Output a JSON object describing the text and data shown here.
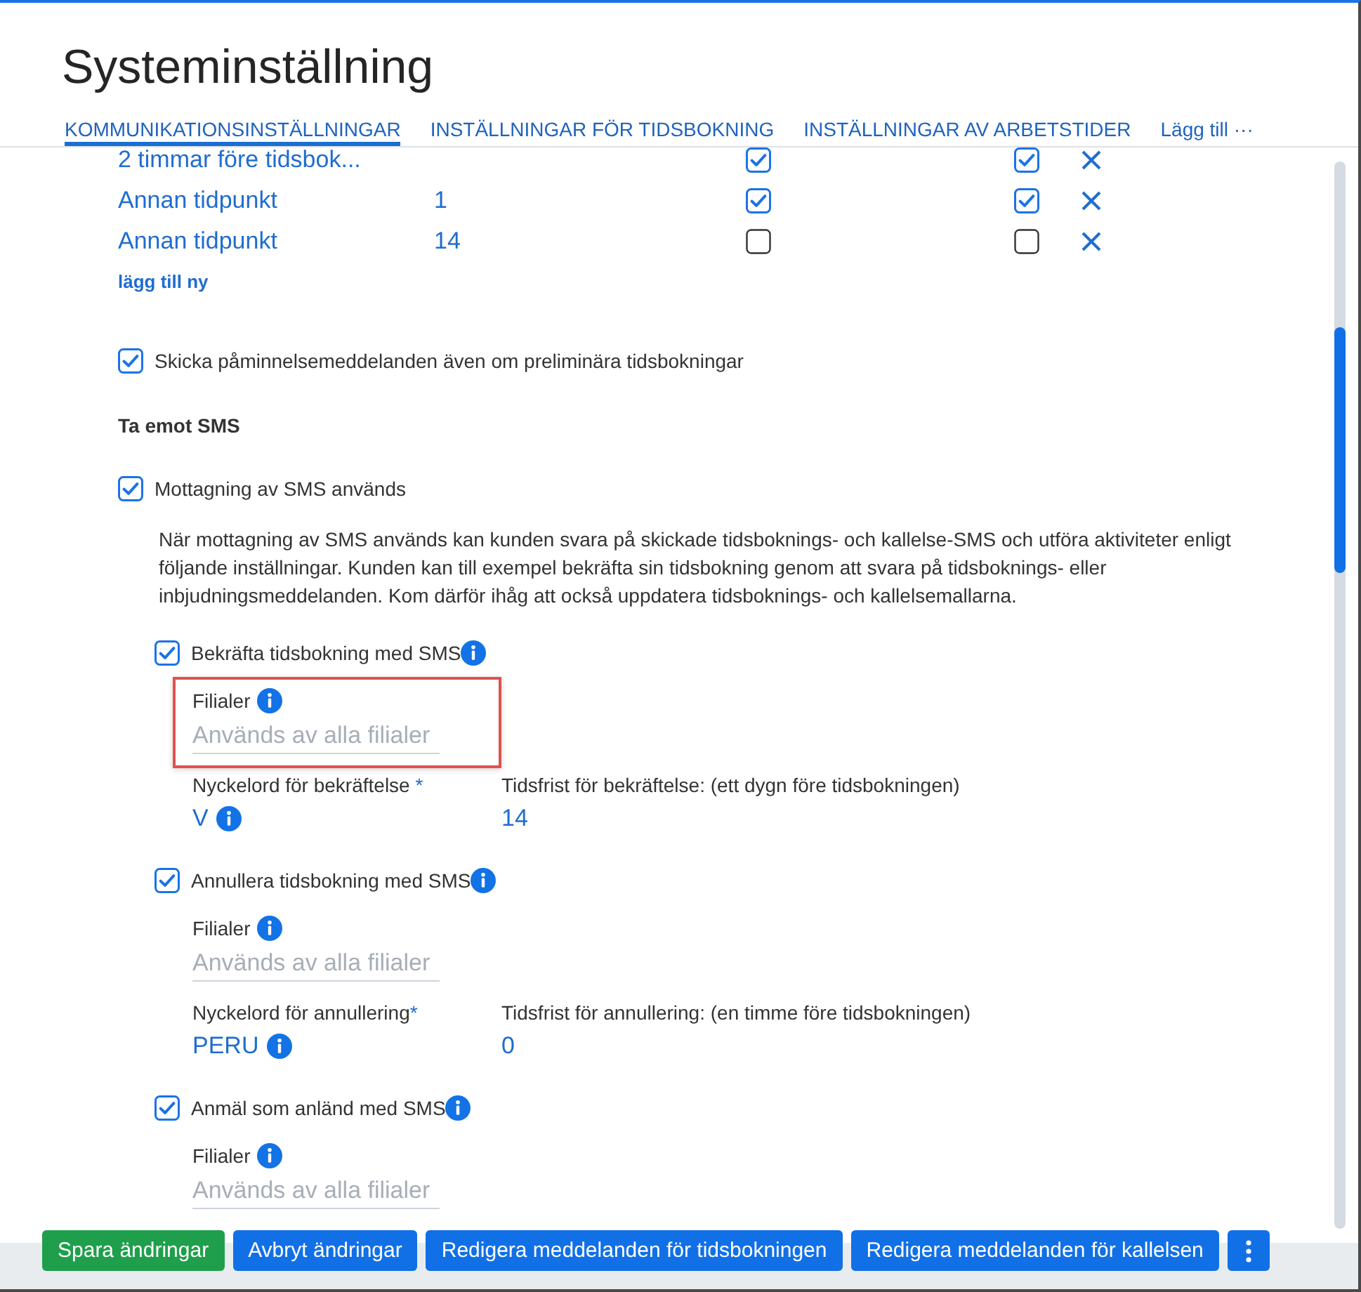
{
  "page": {
    "title": "Systeminställning"
  },
  "tabs": [
    {
      "label": "KOMMUNIKATIONSINSTÄLLNINGAR",
      "selected": true
    },
    {
      "label": "INSTÄLLNINGAR FÖR TIDSBOKNING",
      "selected": false
    },
    {
      "label": "INSTÄLLNINGAR AV ARBETSTIDER",
      "selected": false
    }
  ],
  "tab_menu": {
    "label": "Lägg till ···"
  },
  "reminders": {
    "rows": [
      {
        "time": "2 timmar före tidsbok...",
        "column_3": {
          "checked": true
        },
        "column_4": {
          "checked": true
        }
      },
      {
        "time": "Annan tidpunkt",
        "column_2": "1",
        "column_3": {
          "checked": true
        },
        "column_4": {
          "checked": true
        }
      },
      {
        "time": "Annan tidpunkt",
        "column_2": "14",
        "column_3": {
          "checked": false
        },
        "column_4": {
          "checked": false
        }
      }
    ],
    "add_link": "lägg till ny"
  },
  "preliminary": {
    "label": "Skicka påminnelsemeddelanden även om preliminära tidsbokningar",
    "checked": true
  },
  "receive_sms": {
    "heading": "Ta emot SMS",
    "enabled": {
      "label": "Mottagning av SMS används",
      "checked": true
    },
    "description": "När mottagning av SMS används kan kunden svara på skickade tidsboknings- och kallelse-SMS och utföra aktiviteter enligt följande inställningar. Kunden kan till exempel bekräfta sin tidsbokning genom att svara på tidsboknings- eller inbjudningsmeddelanden. Kom därför ihåg att också uppdatera tidsboknings- och kallelsemallarna.",
    "options": [
      {
        "label": "Bekräfta tidsbokning med SMS",
        "checked": true,
        "branches": {
          "label": "Filialer",
          "placeholder": "Används av alla filialer",
          "highlighted": true
        },
        "keyword": {
          "label": "Nyckelord för bekräftelse",
          "required_mark": " *",
          "value": "V"
        },
        "deadline": {
          "label": "Tidsfrist för bekräftelse: (ett dygn före tidsbokningen)",
          "value": "14"
        }
      },
      {
        "label": "Annullera tidsbokning med SMS",
        "checked": true,
        "branches": {
          "label": "Filialer",
          "placeholder": "Används av alla filialer",
          "highlighted": false
        },
        "keyword": {
          "label": "Nyckelord för annullering",
          "required_mark": "*",
          "value": "PERU"
        },
        "deadline": {
          "label": "Tidsfrist för annullering: (en timme före tidsbokningen)",
          "value": "0"
        }
      },
      {
        "label": "Anmäl som anländ med SMS",
        "checked": true,
        "branches": {
          "label": "Filialer",
          "placeholder": "Används av alla filialer",
          "highlighted": false
        }
      }
    ]
  },
  "actions": [
    {
      "label": "Spara ändringar",
      "kind": "save"
    },
    {
      "label": "Avbryt ändringar",
      "kind": "cancel"
    },
    {
      "label": "Redigera meddelanden för tidsbokningen",
      "kind": "edit"
    },
    {
      "label": "Redigera meddelanden för kallelsen",
      "kind": "edit"
    }
  ]
}
